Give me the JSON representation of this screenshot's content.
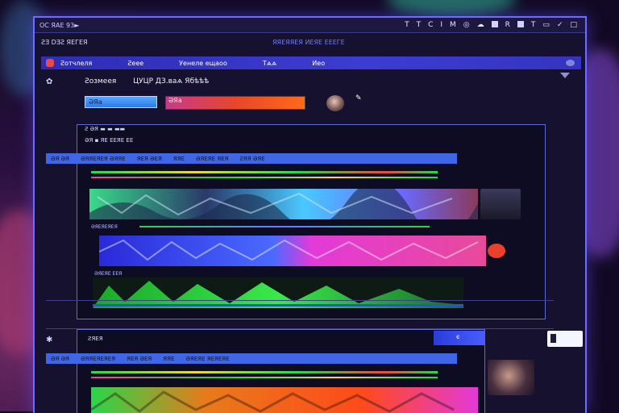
{
  "titlebar": {
    "app_name": "ОС ЯАЕ 93►",
    "icons": [
      "T-icon",
      "T-icon",
      "C-icon",
      "I-icon",
      "M-icon",
      "eye-icon",
      "cloud-icon",
      "square-icon",
      "R-icon",
      "square-icon",
      "T-icon",
      "battery-icon",
      "check-icon",
      "close-icon"
    ]
  },
  "menubar": {
    "left": "ƧƎ  DƎƧ ЯЕГЕЯ",
    "center": "ЯЯЕЯЯЕЯ ИЕЯЕ ЕЕЕГЕ"
  },
  "tabbar": {
    "tabs": [
      "Ƨотчлеля",
      "Ƨеее",
      "Уенеле ещаоо",
      "Тѧѧ",
      "Иео"
    ]
  },
  "header": {
    "title": "Ƨозмеея",
    "subtitle": "ЦУЦР ДЗ.ваѧ Ябѣѣѣ"
  },
  "search": {
    "placeholder": "ƏЯа"
  },
  "progress": {
    "label": "ƏЯа",
    "value": 1.0
  },
  "panel1": {
    "label": "Ƨ ƏЯ ▬ ▬ ▬▬",
    "sublabel": "ƏЯ ▪ ЯЕ ЕЕЯЕ ЕЕ",
    "header_items": [
      "ƏЯ ƏЯ",
      "ƏЯЯЕЯЕЯ ƏЯЯЕ",
      "ЯЕЯ ƏЕЯ",
      "ЯЯЕ",
      "ƏЯЕЯЕ ЯЕЯ",
      "ƧЯЯ ƏЯЕ"
    ],
    "track_label_1": "ƏЯЕЯЕЯЕЯ",
    "track_label_2": "ƏЯЕЯЕ ЕЕЯ"
  },
  "panel2": {
    "label": "ƧЯЕЯ",
    "header_items": [
      "ƏЯ ƏЯ",
      "ƏЯЯЕЯЕЯЕЯ",
      "ЯЕЯ ƏЕЯ",
      "ЯЯЕ",
      "ƏЯЕЯЕ ЯЕЯЕЯЕ"
    ]
  },
  "edge_tab": {
    "label": "ϵ"
  },
  "colors": {
    "accent": "#3f66e6",
    "border": "#6e6cff",
    "bg": "#15112e",
    "track_green": "#2ad64a",
    "track_magenta": "#e43ad8",
    "track_blue": "#3a3ae8",
    "track_orange": "#ff7a1a"
  }
}
